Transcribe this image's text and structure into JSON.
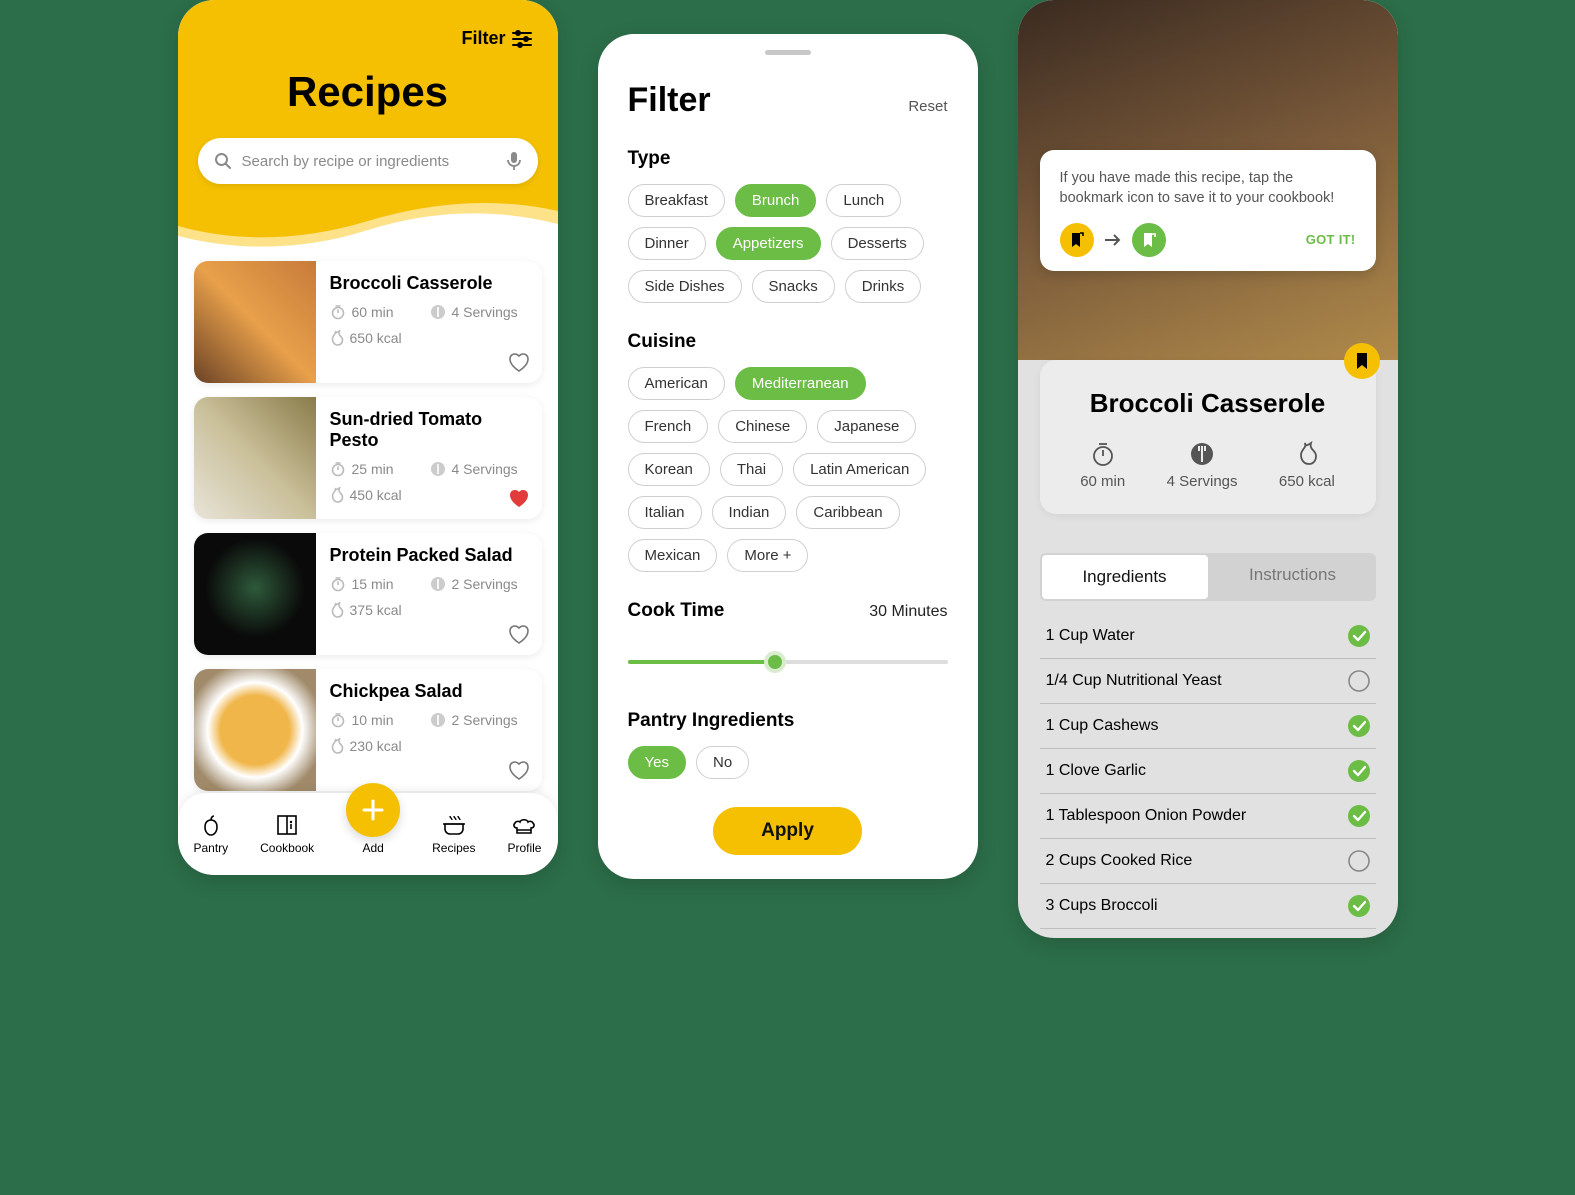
{
  "screen1": {
    "filter_label": "Filter",
    "title": "Recipes",
    "search_placeholder": "Search by recipe or ingredients",
    "recipes": [
      {
        "name": "Broccoli Casserole",
        "time": "60 min",
        "servings": "4 Servings",
        "calories": "650 kcal",
        "fav": false
      },
      {
        "name": "Sun-dried Tomato Pesto",
        "time": "25 min",
        "servings": "4 Servings",
        "calories": "450 kcal",
        "fav": true
      },
      {
        "name": "Protein Packed Salad",
        "time": "15 min",
        "servings": "2 Servings",
        "calories": "375 kcal",
        "fav": false
      },
      {
        "name": "Chickpea Salad",
        "time": "10 min",
        "servings": "2 Servings",
        "calories": "230 kcal",
        "fav": false
      }
    ],
    "tabs": {
      "pantry": "Pantry",
      "cookbook": "Cookbook",
      "add": "Add",
      "recipes": "Recipes",
      "profile": "Profile"
    }
  },
  "screen2": {
    "title": "Filter",
    "reset": "Reset",
    "type_label": "Type",
    "types": [
      {
        "label": "Breakfast",
        "active": false
      },
      {
        "label": "Brunch",
        "active": true
      },
      {
        "label": "Lunch",
        "active": false
      },
      {
        "label": "Dinner",
        "active": false
      },
      {
        "label": "Appetizers",
        "active": true
      },
      {
        "label": "Desserts",
        "active": false
      },
      {
        "label": "Side Dishes",
        "active": false
      },
      {
        "label": "Snacks",
        "active": false
      },
      {
        "label": "Drinks",
        "active": false
      }
    ],
    "cuisine_label": "Cuisine",
    "cuisines": [
      {
        "label": "American",
        "active": false
      },
      {
        "label": "Mediterranean",
        "active": true
      },
      {
        "label": "French",
        "active": false
      },
      {
        "label": "Chinese",
        "active": false
      },
      {
        "label": "Japanese",
        "active": false
      },
      {
        "label": "Korean",
        "active": false
      },
      {
        "label": "Thai",
        "active": false
      },
      {
        "label": "Latin American",
        "active": false
      },
      {
        "label": "Italian",
        "active": false
      },
      {
        "label": "Indian",
        "active": false
      },
      {
        "label": "Caribbean",
        "active": false
      },
      {
        "label": "Mexican",
        "active": false
      },
      {
        "label": "More +",
        "active": false
      }
    ],
    "cooktime_label": "Cook Time",
    "cooktime_value": "30 Minutes",
    "pantry_label": "Pantry Ingredients",
    "pantry_options": [
      {
        "label": "Yes",
        "active": true
      },
      {
        "label": "No",
        "active": false
      }
    ],
    "apply": "Apply"
  },
  "screen3": {
    "tip_text": "If you have made this recipe, tap the bookmark icon to save it to your cookbook!",
    "gotit": "GOT IT!",
    "title": "Broccoli Casserole",
    "time": "60 min",
    "servings": "4 Servings",
    "calories": "650 kcal",
    "tab_ingredients": "Ingredients",
    "tab_instructions": "Instructions",
    "ingredients": [
      {
        "label": "1 Cup Water",
        "checked": true
      },
      {
        "label": "1/4 Cup Nutritional Yeast",
        "checked": false
      },
      {
        "label": "1 Cup Cashews",
        "checked": true
      },
      {
        "label": "1 Clove Garlic",
        "checked": true
      },
      {
        "label": "1 Tablespoon Onion Powder",
        "checked": true
      },
      {
        "label": "2 Cups Cooked Rice",
        "checked": false
      },
      {
        "label": "3 Cups Broccoli",
        "checked": true
      }
    ]
  }
}
